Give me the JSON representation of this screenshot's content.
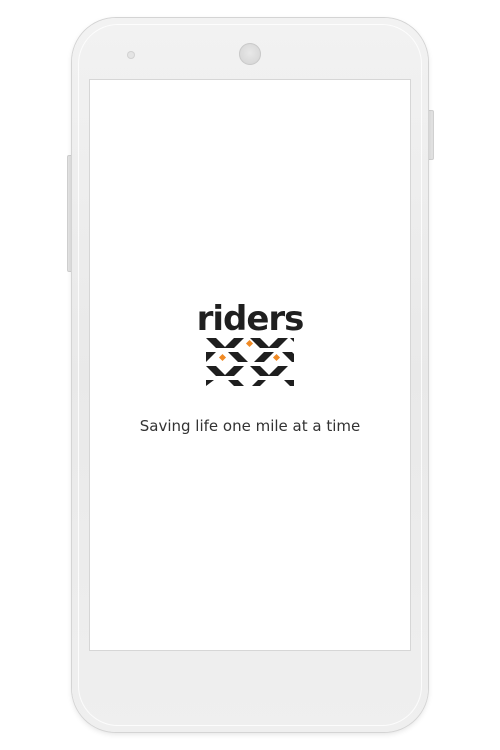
{
  "app": {
    "brand_name": "riders",
    "tagline": "Saving life one mile at a time"
  },
  "colors": {
    "brand_dark": "#1f1f1f",
    "brand_accent": "#f08a24",
    "screen_bg": "#ffffff",
    "phone_body": "#ececec"
  },
  "icons": {
    "logo_pattern": "woven-chevron-pattern-icon"
  }
}
